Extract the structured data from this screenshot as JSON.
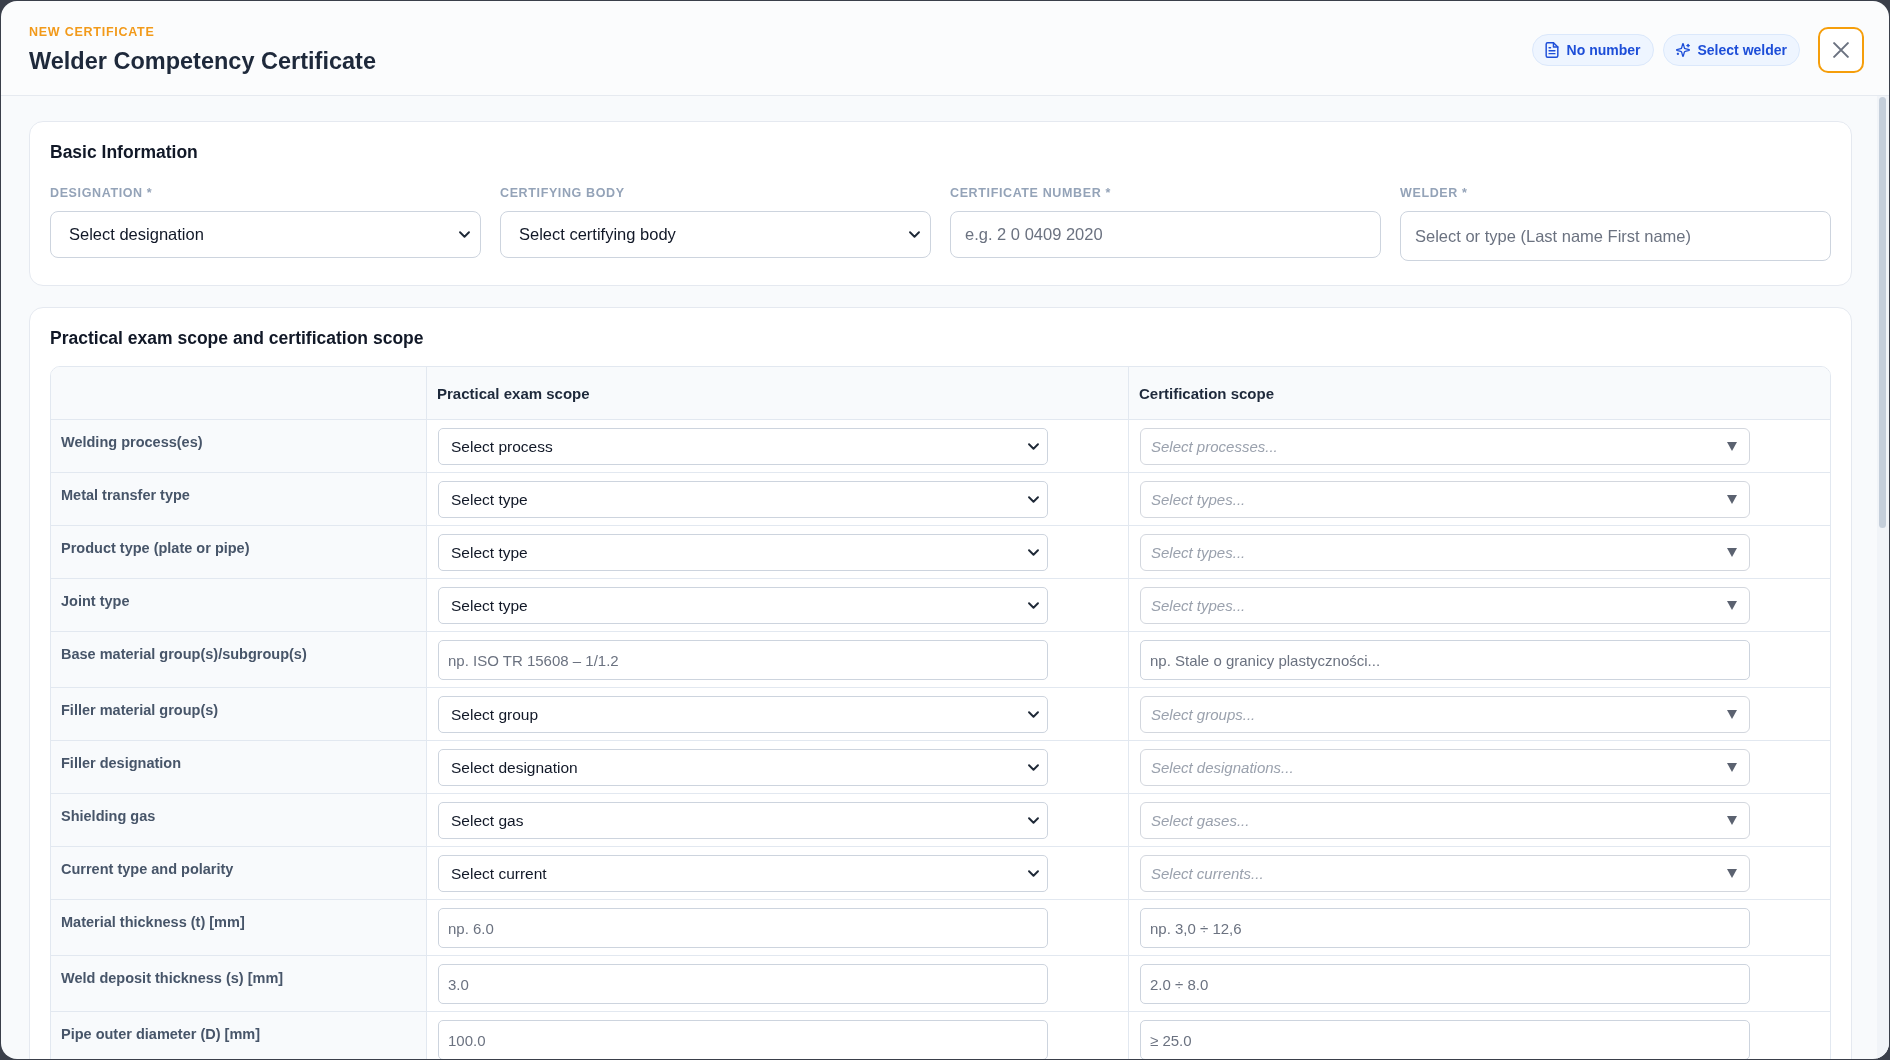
{
  "header": {
    "eyebrow": "NEW CERTIFICATE",
    "title": "Welder Competency Certificate",
    "actions": [
      {
        "label": "No number"
      },
      {
        "label": "Select welder"
      }
    ],
    "close_button": {
      "focused": true
    }
  },
  "basic_information": {
    "title": "Basic Information",
    "fields": [
      {
        "label": "DESIGNATION *",
        "kind": "select",
        "value": "Select designation"
      },
      {
        "label": "CERTIFYING BODY",
        "kind": "select",
        "value": "Select certifying body"
      },
      {
        "label": "CERTIFICATE NUMBER *",
        "kind": "input",
        "placeholder": "e.g. 2 0 0409 2020"
      },
      {
        "label": "WELDER *",
        "kind": "input",
        "placeholder": "Select or type (Last name First name)"
      }
    ]
  },
  "scope": {
    "title": "Practical exam scope and certification scope",
    "columns": [
      "Practical exam scope",
      "Certification scope"
    ],
    "rows": [
      {
        "label": "Welding process(es)",
        "practical": {
          "kind": "select",
          "value": "Select process"
        },
        "certification": {
          "kind": "multiselect",
          "placeholder": "Select processes..."
        }
      },
      {
        "label": "Metal transfer type",
        "practical": {
          "kind": "select",
          "value": "Select type"
        },
        "certification": {
          "kind": "multiselect",
          "placeholder": "Select types..."
        }
      },
      {
        "label": "Product type (plate or pipe)",
        "practical": {
          "kind": "select",
          "value": "Select type"
        },
        "certification": {
          "kind": "multiselect",
          "placeholder": "Select types..."
        }
      },
      {
        "label": "Joint type",
        "practical": {
          "kind": "select",
          "value": "Select type"
        },
        "certification": {
          "kind": "multiselect",
          "placeholder": "Select types..."
        }
      },
      {
        "label": "Base material group(s)/subgroup(s)",
        "practical": {
          "kind": "input",
          "placeholder": "np. ISO TR 15608 – 1/1.2"
        },
        "certification": {
          "kind": "input",
          "placeholder": "np. Stale o granicy plastyczności..."
        }
      },
      {
        "label": "Filler material group(s)",
        "practical": {
          "kind": "select",
          "value": "Select group"
        },
        "certification": {
          "kind": "multiselect",
          "placeholder": "Select groups..."
        }
      },
      {
        "label": "Filler designation",
        "practical": {
          "kind": "select",
          "value": "Select designation"
        },
        "certification": {
          "kind": "multiselect",
          "placeholder": "Select designations..."
        }
      },
      {
        "label": "Shielding gas",
        "practical": {
          "kind": "select",
          "value": "Select gas"
        },
        "certification": {
          "kind": "multiselect",
          "placeholder": "Select gases..."
        }
      },
      {
        "label": "Current type and polarity",
        "practical": {
          "kind": "select",
          "value": "Select current"
        },
        "certification": {
          "kind": "multiselect",
          "placeholder": "Select currents..."
        }
      },
      {
        "label": "Material thickness (t) [mm]",
        "practical": {
          "kind": "input",
          "placeholder": "np. 6.0"
        },
        "certification": {
          "kind": "input",
          "placeholder": "np. 3,0 ÷ 12,6"
        }
      },
      {
        "label": "Weld deposit thickness (s) [mm]",
        "practical": {
          "kind": "input",
          "placeholder": "3.0"
        },
        "certification": {
          "kind": "input",
          "placeholder": "2.0 ÷ 8.0"
        }
      },
      {
        "label": "Pipe outer diameter (D) [mm]",
        "practical": {
          "kind": "input",
          "placeholder": "100.0"
        },
        "certification": {
          "kind": "input",
          "placeholder": "≥ 25.0"
        }
      }
    ]
  }
}
